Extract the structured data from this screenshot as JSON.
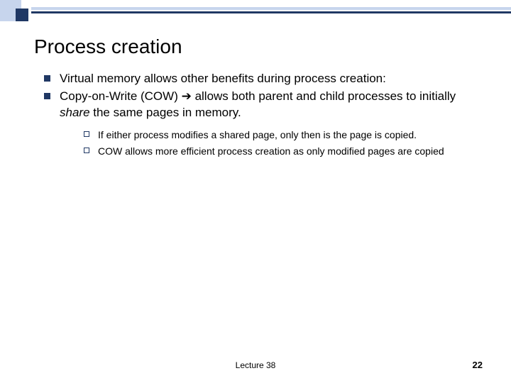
{
  "title": "Process creation",
  "bullets": [
    {
      "text": "Virtual memory allows other benefits during process creation:"
    },
    {
      "pre": "Copy-on-Write (COW) ",
      "arrow": "➔",
      "mid": " allows both parent and child processes to initially ",
      "italic": "share",
      "post": " the same pages in memory."
    }
  ],
  "subbullets": [
    "If either process modifies a shared page, only then is the page is copied.",
    "COW allows more efficient process creation as only modified pages are copied"
  ],
  "footer": {
    "center": "Lecture 38",
    "page": "22"
  }
}
